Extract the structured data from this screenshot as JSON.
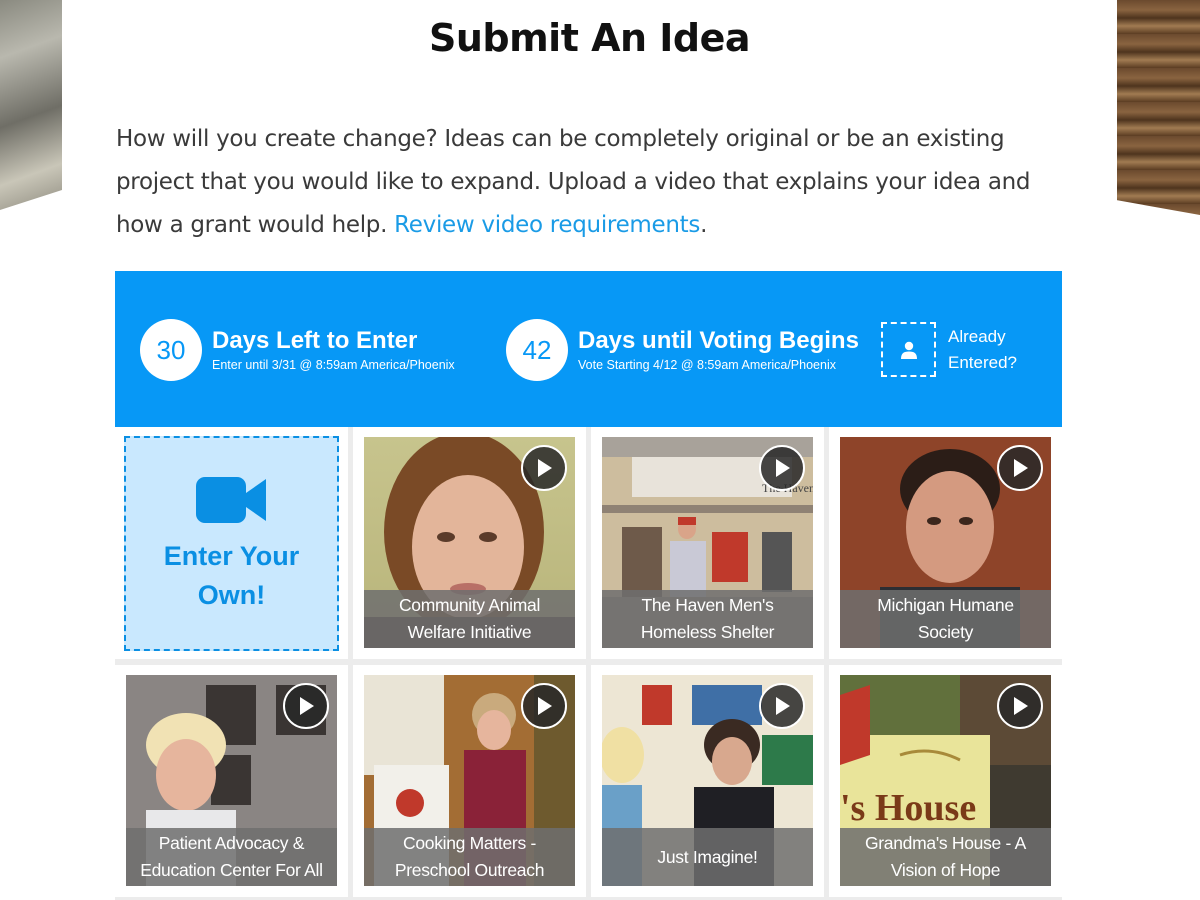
{
  "page": {
    "title": "Submit An Idea",
    "intro_text": "How will you create change? Ideas can be completely original or be an existing project that you would like to expand. Upload a video that explains your idea and how a grant would help.",
    "intro_link": "Review video requirements",
    "intro_end": "."
  },
  "banner": {
    "enter": {
      "count": "30",
      "headline": "Days Left to Enter",
      "detail": "Enter until 3/31 @ 8:59am America/Phoenix"
    },
    "voting": {
      "count": "42",
      "headline": "Days until Voting Begins",
      "detail": "Vote Starting 4/12 @ 8:59am America/Phoenix"
    },
    "already_entered": {
      "line1": "Already",
      "line2": "Entered?",
      "icon": "user-icon"
    },
    "color": "#0798f6"
  },
  "enter_own": {
    "label_line1": "Enter Your",
    "label_line2": "Own!",
    "icon": "video-camera-icon"
  },
  "videos": [
    {
      "line1": "Community Animal",
      "line2": "Welfare Initiative"
    },
    {
      "line1": "The Haven Men's",
      "line2": "Homeless Shelter"
    },
    {
      "line1": "Michigan Humane",
      "line2": "Society"
    },
    {
      "line1": "Patient Advocacy &",
      "line2": "Education Center For All"
    },
    {
      "line1": "Cooking Matters -",
      "line2": "Preschool Outreach"
    },
    {
      "line1": "Just Imagine!",
      "line2": ""
    },
    {
      "line1": "Grandma's House - A",
      "line2": "Vision of Hope"
    }
  ],
  "thumbnail_signs": {
    "haven_sign": "The Haven",
    "grandmas_sign": "'s House"
  }
}
